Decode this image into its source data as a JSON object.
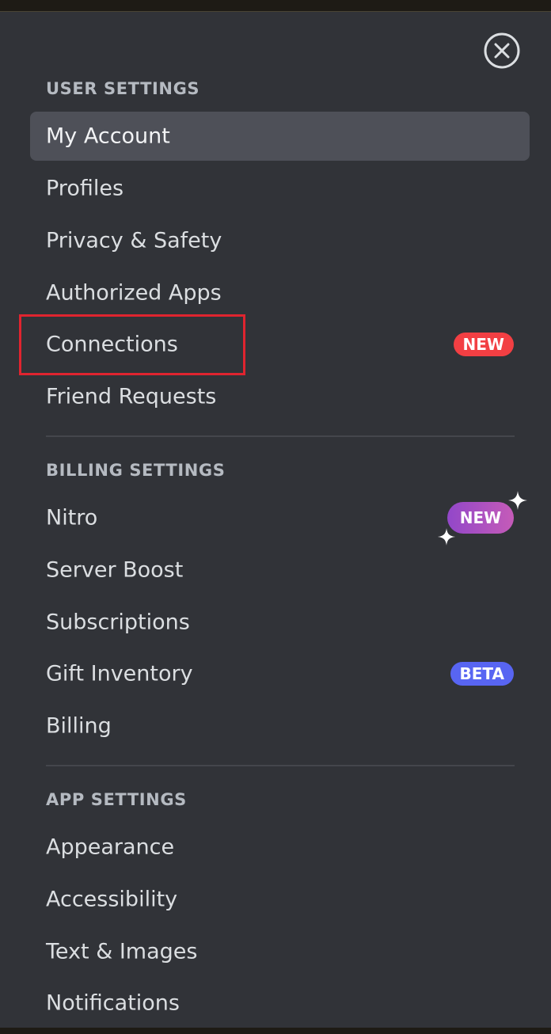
{
  "close_icon": "close-circle-icon",
  "sections": [
    {
      "header": "USER SETTINGS",
      "items": [
        {
          "label": "My Account",
          "selected": true
        },
        {
          "label": "Profiles"
        },
        {
          "label": "Privacy & Safety"
        },
        {
          "label": "Authorized Apps"
        },
        {
          "label": "Connections",
          "badge": "NEW",
          "badge_color": "#f23f43",
          "highlighted": true
        },
        {
          "label": "Friend Requests"
        }
      ]
    },
    {
      "header": "BILLING SETTINGS",
      "items": [
        {
          "label": "Nitro",
          "badge": "NEW",
          "badge_color": "#9247c9"
        },
        {
          "label": "Server Boost"
        },
        {
          "label": "Subscriptions"
        },
        {
          "label": "Gift Inventory",
          "badge": "BETA",
          "badge_color": "#5865f2"
        },
        {
          "label": "Billing"
        }
      ]
    },
    {
      "header": "APP SETTINGS",
      "items": [
        {
          "label": "Appearance"
        },
        {
          "label": "Accessibility"
        },
        {
          "label": "Text & Images"
        },
        {
          "label": "Notifications"
        }
      ]
    }
  ],
  "colors": {
    "background": "#313338",
    "selected_background": "#4e5058",
    "highlight_border": "#e0242f"
  }
}
